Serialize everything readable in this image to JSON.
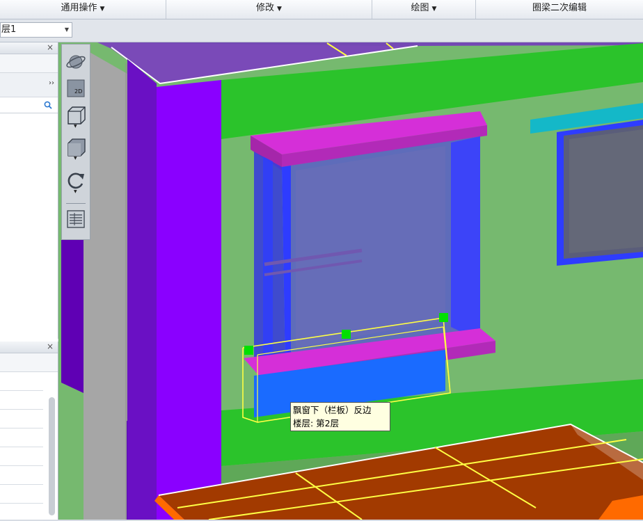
{
  "ribbon": {
    "groups": [
      {
        "label": "通用操作",
        "dropdown": true
      },
      {
        "label": "修改",
        "dropdown": true
      },
      {
        "label": "绘图",
        "dropdown": true
      },
      {
        "label": "圈梁二次编辑",
        "dropdown": false
      }
    ]
  },
  "toolbar": {
    "floor_select_value": "层1"
  },
  "panel_top": {
    "collapse_arrow": "››"
  },
  "panel_bottom": {},
  "view_toolbar": {
    "buttons": [
      "orbit-icon",
      "2d-view-icon",
      "3d-box-icon",
      "solid-box-icon",
      "rotate-icon",
      "layer-list-icon"
    ],
    "label_2d": "2D"
  },
  "tooltip": {
    "line1": "飘窗下（栏板）反边",
    "line2": "楼层: 第2层"
  },
  "colors": {
    "wall_green": "#2bc32b",
    "column_purple": "#7a00e6",
    "window_frame": "#2e3cff",
    "sill_magenta": "#c330c8",
    "slab_brown": "#a23a00",
    "highlight_yellow": "#ffff44",
    "grip_green": "#00e000"
  }
}
